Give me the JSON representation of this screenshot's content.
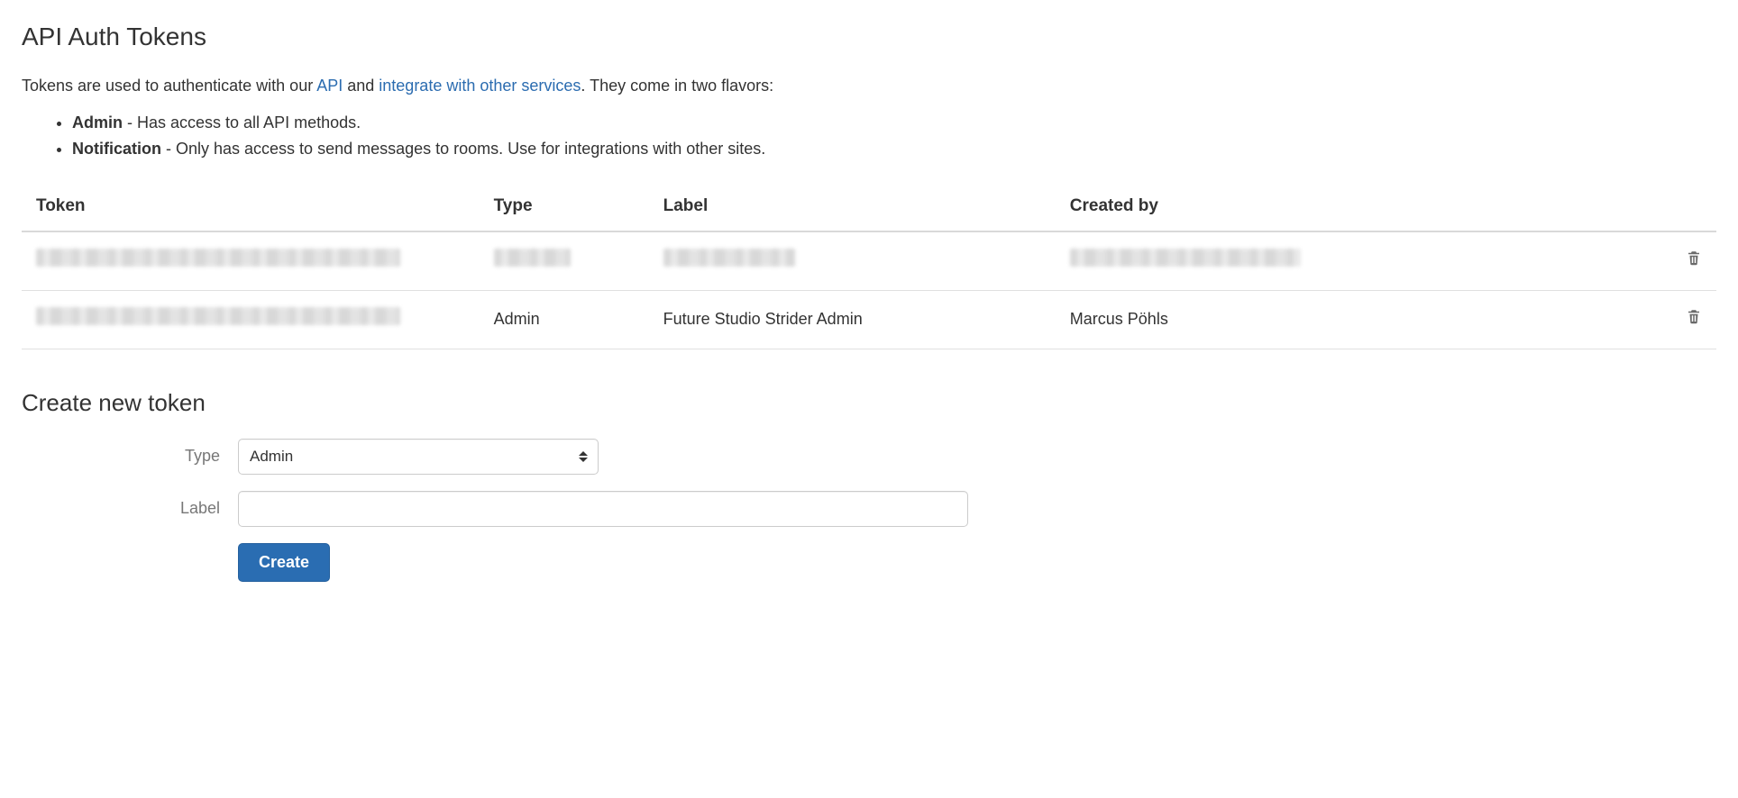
{
  "page": {
    "title": "API Auth Tokens",
    "description_pre": "Tokens are used to authenticate with our ",
    "link_api": "API",
    "description_mid": " and ",
    "link_integrate": "integrate with other services",
    "description_post": ". They come in two flavors:",
    "flavors": [
      {
        "name": "Admin",
        "desc": " - Has access to all API methods."
      },
      {
        "name": "Notification",
        "desc": " - Only has access to send messages to rooms. Use for integrations with other sites."
      }
    ]
  },
  "table": {
    "headers": {
      "token": "Token",
      "type": "Type",
      "label": "Label",
      "created_by": "Created by"
    },
    "rows": [
      {
        "token_obscured": true,
        "type_obscured": true,
        "label_obscured": true,
        "created_by_obscured": true,
        "type": "",
        "label": "",
        "created_by": ""
      },
      {
        "token_obscured": true,
        "type_obscured": false,
        "label_obscured": false,
        "created_by_obscured": false,
        "type": "Admin",
        "label": "Future Studio Strider Admin",
        "created_by": "Marcus Pöhls"
      }
    ]
  },
  "form": {
    "title": "Create new token",
    "type_label": "Type",
    "type_value": "Admin",
    "label_label": "Label",
    "label_value": "",
    "submit": "Create"
  }
}
